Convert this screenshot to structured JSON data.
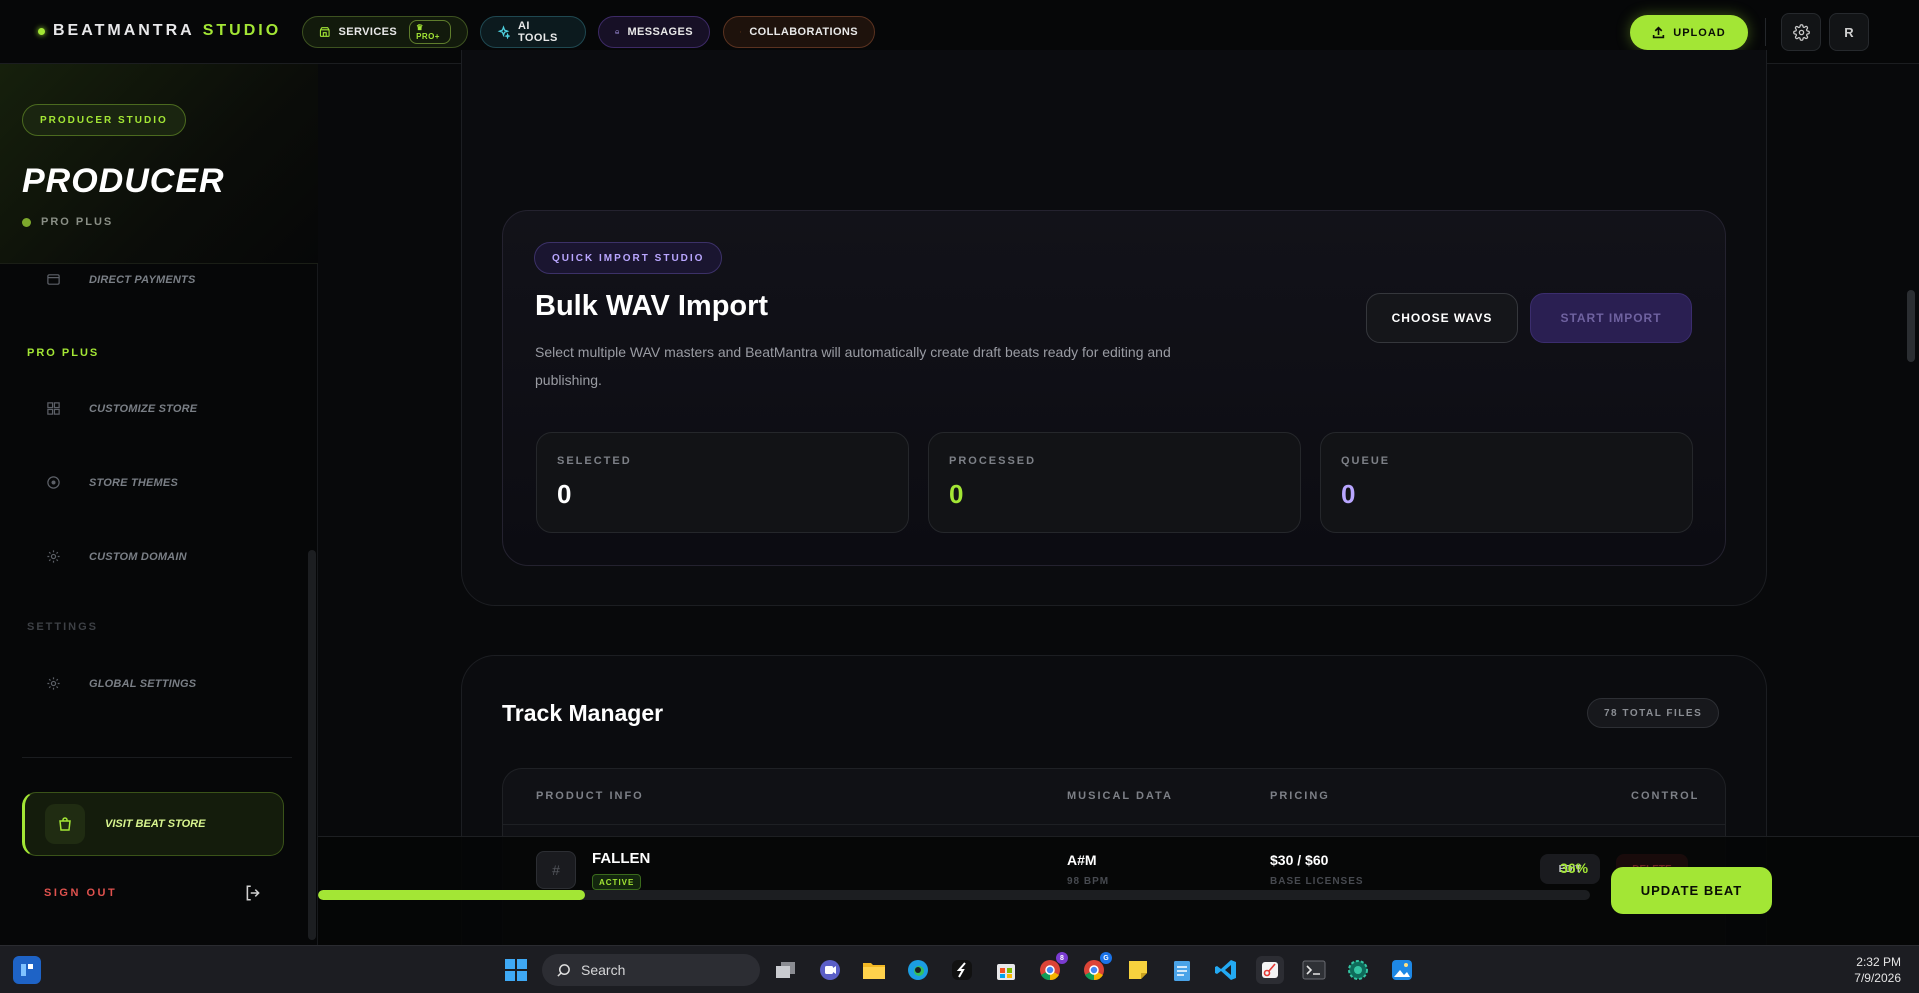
{
  "brand": {
    "name": "BEATMANTRA",
    "suffix": "STUDIO"
  },
  "nav": {
    "services": "SERVICES",
    "services_badge": "PRO+",
    "ai_tools": "AI TOOLS",
    "messages": "MESSAGES",
    "collaborations": "COLLABORATIONS"
  },
  "header": {
    "upload": "UPLOAD",
    "avatar_initial": "R"
  },
  "sidebar": {
    "studio_pill": "PRODUCER STUDIO",
    "title": "PRODUCER",
    "plan": "PRO PLUS",
    "direct_payments": "DIRECT PAYMENTS",
    "section_pro": "PRO PLUS",
    "customize_store": "CUSTOMIZE STORE",
    "store_themes": "STORE THEMES",
    "custom_domain": "CUSTOM DOMAIN",
    "section_settings": "SETTINGS",
    "global_settings": "GLOBAL SETTINGS",
    "visit_store": "VISIT BEAT STORE",
    "sign_out": "SIGN OUT"
  },
  "import": {
    "pill": "QUICK IMPORT STUDIO",
    "title": "Bulk WAV Import",
    "description": "Select multiple WAV masters and BeatMantra will automatically create draft beats ready for editing and publishing.",
    "choose": "CHOOSE WAVS",
    "start": "START IMPORT",
    "stats": {
      "selected_label": "SELECTED",
      "selected_value": "0",
      "processed_label": "PROCESSED",
      "processed_value": "0",
      "queue_label": "QUEUE",
      "queue_value": "0"
    }
  },
  "tracks": {
    "title": "Track Manager",
    "count": "78 TOTAL FILES",
    "columns": {
      "product": "PRODUCT INFO",
      "musical": "MUSICAL DATA",
      "pricing": "PRICING",
      "control": "CONTROL"
    },
    "row": {
      "thumb": "#",
      "name": "FALLEN",
      "status": "ACTIVE",
      "key": "A#M",
      "bpm": "98 BPM",
      "price": "$30 / $60",
      "licenses": "BASE LICENSES",
      "edit": "EDIT",
      "delete": "DELETE"
    }
  },
  "update_bar": {
    "percent_label": "36%",
    "progress": 0.21,
    "button": "UPDATE BEAT"
  },
  "taskbar": {
    "search": "Search",
    "time": "2:32 PM",
    "date": "7/9/2026",
    "badge_b": "8",
    "badge_g": "G"
  },
  "colors": {
    "accent": "#a3e635",
    "purple": "#b9a6ff",
    "danger": "#e0524e"
  }
}
